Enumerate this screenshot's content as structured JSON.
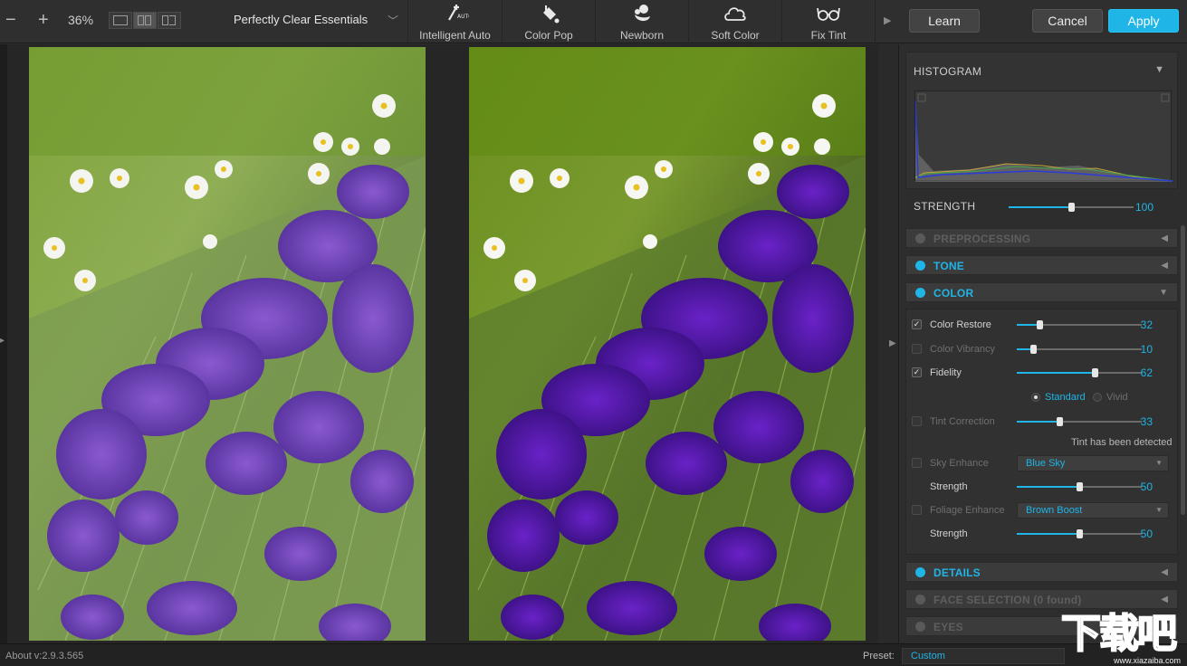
{
  "toolbar": {
    "zoom_out_icon": "minus-icon",
    "zoom_in_icon": "plus-icon",
    "zoom_level": "36%",
    "preset_group": "Perfectly Clear Essentials",
    "presets": [
      {
        "label": "Intelligent Auto",
        "icon": "auto-wand-icon"
      },
      {
        "label": "Color Pop",
        "icon": "paint-bucket-icon"
      },
      {
        "label": "Newborn",
        "icon": "baby-icon"
      },
      {
        "label": "Soft Color",
        "icon": "cloud-icon"
      },
      {
        "label": "Fix Tint",
        "icon": "glasses-icon"
      }
    ],
    "learn_label": "Learn",
    "cancel_label": "Cancel",
    "apply_label": "Apply",
    "accent_color": "#1fb5e6"
  },
  "panel": {
    "histogram": {
      "title": "HISTOGRAM"
    },
    "strength": {
      "label": "STRENGTH",
      "value": "100",
      "level": 0.5
    },
    "sections": {
      "preprocessing": "PREPROCESSING",
      "tone": "TONE",
      "color": "COLOR",
      "details": "DETAILS",
      "face_selection": "FACE SELECTION (0 found)",
      "eyes": "EYES"
    },
    "color": {
      "color_restore": {
        "label": "Color Restore",
        "value": "32",
        "checked": true,
        "level": 0.18
      },
      "color_vibrancy": {
        "label": "Color Vibrancy",
        "value": "10",
        "checked": false,
        "level": 0.13
      },
      "fidelity": {
        "label": "Fidelity",
        "value": "62",
        "checked": true,
        "level": 0.62
      },
      "fidelity_mode": {
        "standard": "Standard",
        "vivid": "Vivid"
      },
      "tint_correction": {
        "label": "Tint Correction",
        "value": "33",
        "checked": false,
        "level": 0.34
      },
      "tint_note": "Tint has been detected",
      "sky_enhance": {
        "label": "Sky Enhance",
        "option": "Blue Sky",
        "checked": false
      },
      "sky_strength": {
        "label": "Strength",
        "value": "50",
        "level": 0.5
      },
      "foliage_enhance": {
        "label": "Foliage Enhance",
        "option": "Brown Boost",
        "checked": false
      },
      "foliage_strength": {
        "label": "Strength",
        "value": "50",
        "level": 0.5
      }
    }
  },
  "statusbar": {
    "about": "About v:2.9.3.565",
    "preset_label": "Preset:",
    "preset_value": "Custom"
  },
  "watermark": {
    "logo": "下载吧",
    "domain": "www.xiazaiba.com"
  }
}
